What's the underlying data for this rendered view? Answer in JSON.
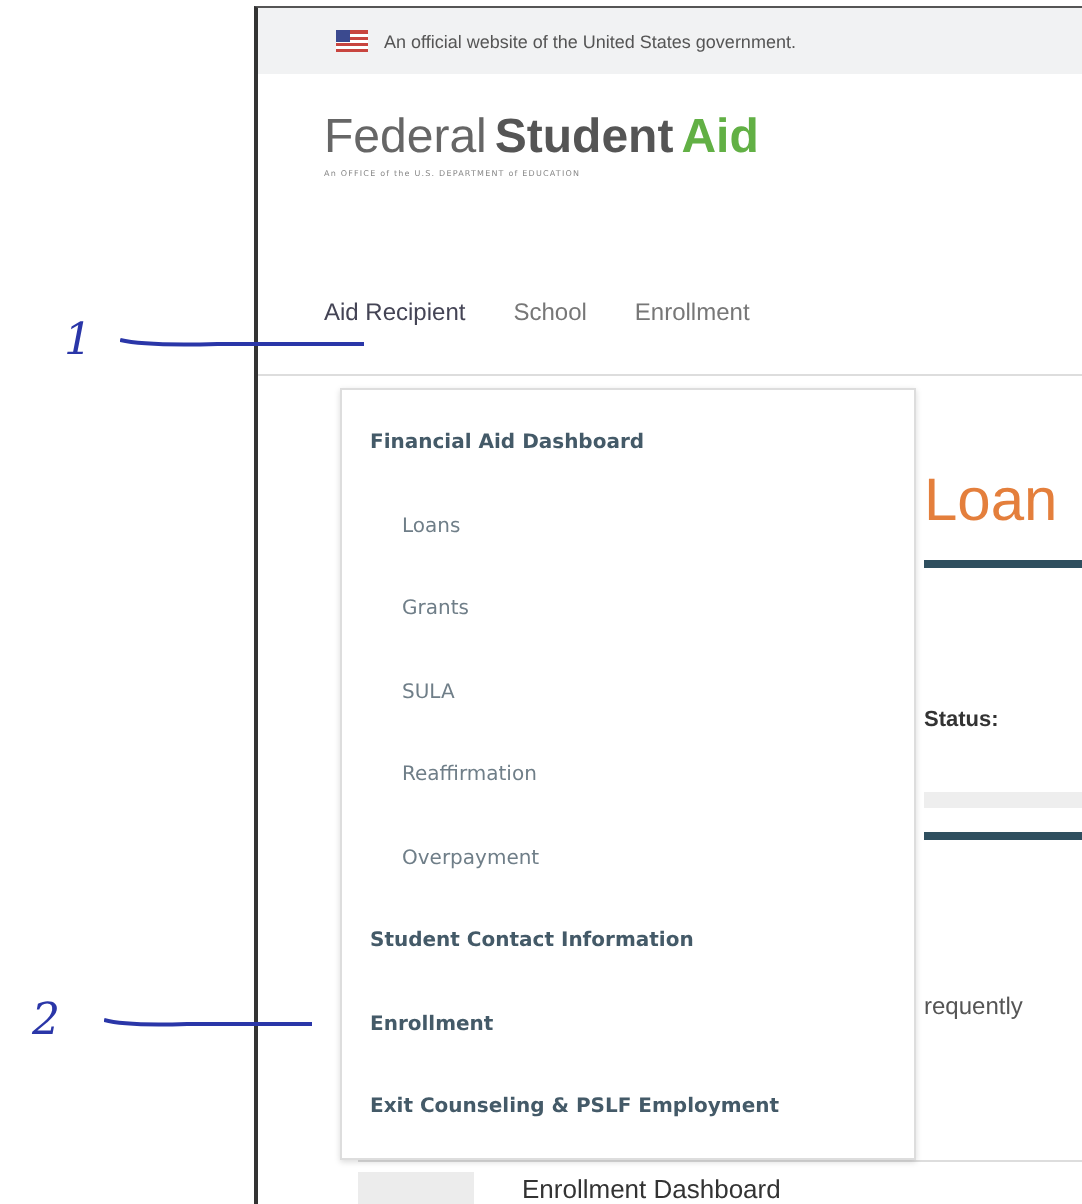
{
  "gov_banner": {
    "text": "An official website of the United States government."
  },
  "logo": {
    "parts": [
      "Federal",
      "Student",
      "Aid"
    ],
    "tagline": "An OFFICE of the U.S. DEPARTMENT of EDUCATION"
  },
  "nav": {
    "items": [
      {
        "label": "Aid Recipient",
        "selected": true
      },
      {
        "label": "School",
        "selected": false
      },
      {
        "label": "Enrollment",
        "selected": false
      }
    ]
  },
  "dropdown": {
    "items": [
      {
        "label": "Financial Aid Dashboard",
        "kind": "heading"
      },
      {
        "label": "Loans",
        "kind": "sub"
      },
      {
        "label": "Grants",
        "kind": "sub"
      },
      {
        "label": "SULA",
        "kind": "sub"
      },
      {
        "label": "Reaffirmation",
        "kind": "sub"
      },
      {
        "label": "Overpayment",
        "kind": "sub"
      },
      {
        "label": "Student Contact Information",
        "kind": "heading"
      },
      {
        "label": "Enrollment",
        "kind": "heading"
      },
      {
        "label": "Exit Counseling & PSLF Employment",
        "kind": "heading"
      }
    ]
  },
  "page": {
    "heading": "Loan",
    "status_label": "Status:",
    "partial_text": "requently",
    "card_title": "Enrollment Dashboard"
  },
  "annotations": [
    {
      "label": "1"
    },
    {
      "label": "2"
    }
  ]
}
